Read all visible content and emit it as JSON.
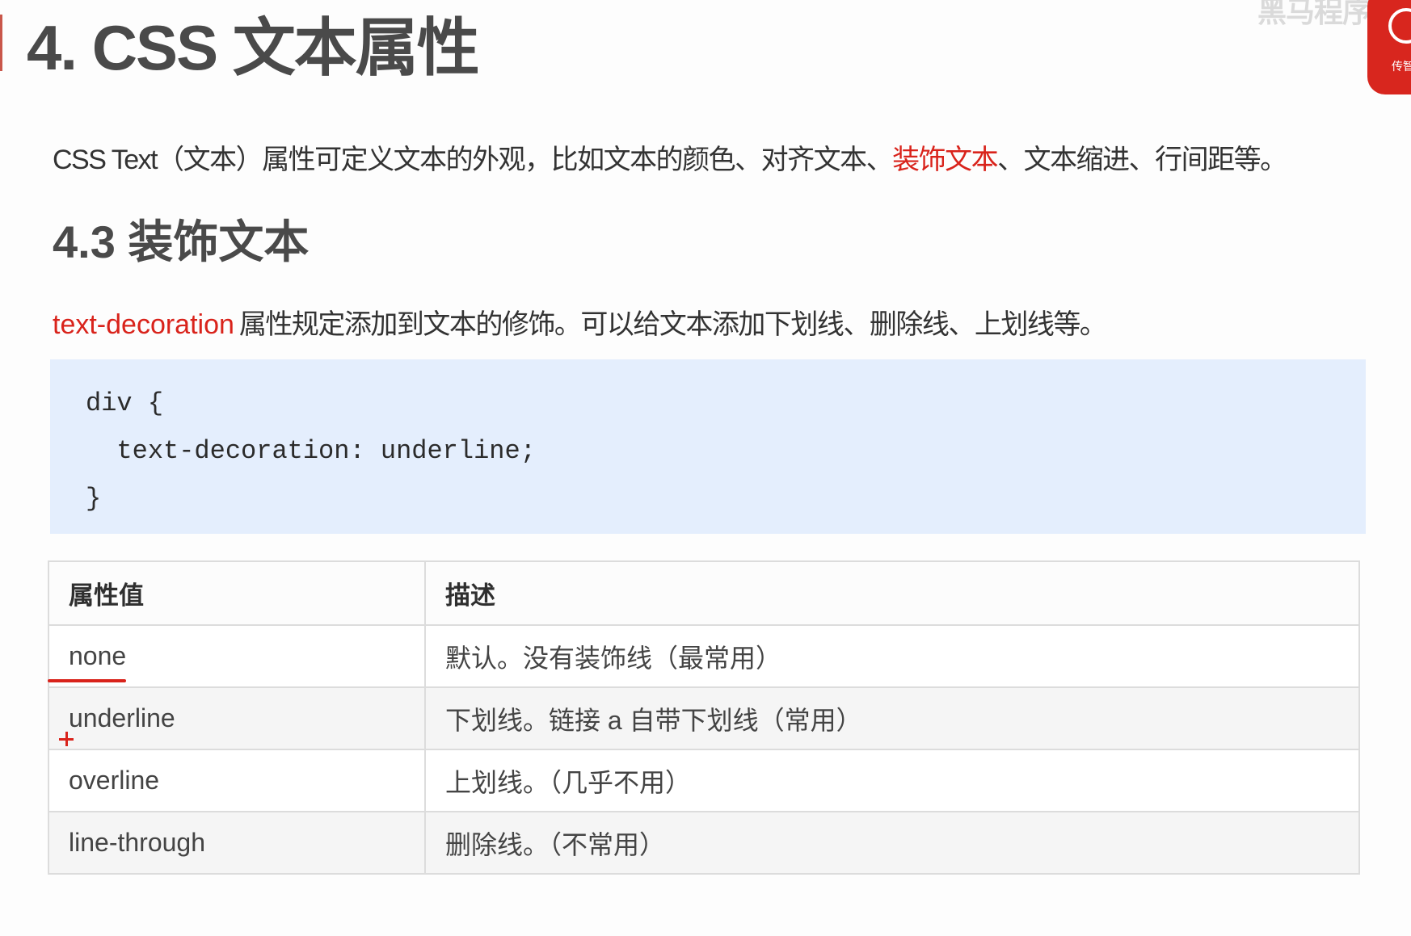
{
  "colors": {
    "page_background": "#fdfdfd",
    "heading_text": "#4a4a4a",
    "body_text": "#333333",
    "highlight_red": "#d9231b",
    "code_background": "#e4eefd",
    "table_border": "#dcdcdc",
    "table_stripe": "#f5f5f5",
    "logo_red": "#d8261e"
  },
  "logo": {
    "watermark_text": "黑马程序",
    "badge_text": "传智",
    "badge_icon": "circle-ring-icon"
  },
  "title": "4. CSS 文本属性",
  "intro": {
    "text_before": "CSS Text（文本）属性可定义文本的外观，比如文本的颜色、对齐文本、",
    "highlight": "装饰文本",
    "text_after": "、文本缩进、行间距等。"
  },
  "section_heading": "4.3 装饰文本",
  "description": {
    "highlight": "text-decoration",
    "text_after": "属性规定添加到文本的修饰。可以给文本添加下划线、删除线、上划线等。"
  },
  "code_example": {
    "lines": [
      "div {",
      "  text-decoration: underline;",
      "}"
    ]
  },
  "values_table": {
    "headers": [
      "属性值",
      "描述"
    ],
    "rows": [
      [
        "none",
        "默认。没有装饰线（最常用）"
      ],
      [
        "underline",
        "下划线。链接 a 自带下划线（常用）"
      ],
      [
        "overline",
        "上划线。（几乎不用）"
      ],
      [
        "line-through",
        "删除线。（不常用）"
      ]
    ]
  },
  "annotations": {
    "stroke_icon": "red-underline-mark",
    "cursor_icon": "crosshair-icon"
  }
}
